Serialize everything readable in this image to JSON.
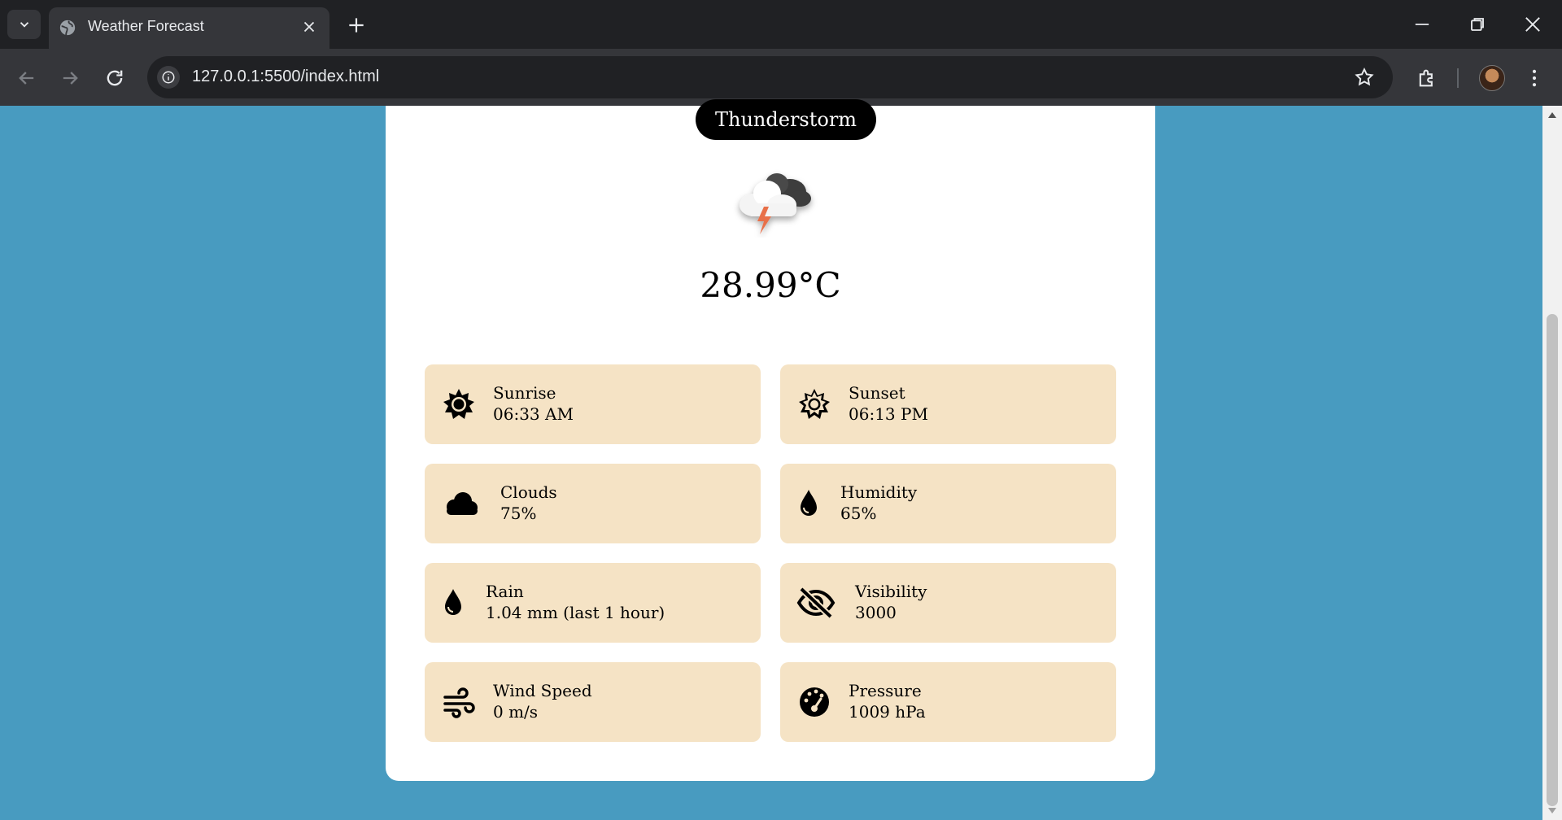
{
  "browser": {
    "tab_title": "Weather Forecast",
    "url": "127.0.0.1:5500/index.html"
  },
  "weather": {
    "condition": "Thunderstorm",
    "temperature": "28.99°C",
    "icon": "thunderstorm-cloud-icon",
    "stats": [
      {
        "label": "Sunrise",
        "value": "06:33 AM",
        "icon": "sun-icon"
      },
      {
        "label": "Sunset",
        "value": "06:13 PM",
        "icon": "sun-outline-icon"
      },
      {
        "label": "Clouds",
        "value": "75%",
        "icon": "cloud-icon"
      },
      {
        "label": "Humidity",
        "value": "65%",
        "icon": "droplet-icon"
      },
      {
        "label": "Rain",
        "value": "1.04 mm (last 1 hour)",
        "icon": "droplet-icon"
      },
      {
        "label": "Visibility",
        "value": "3000",
        "icon": "eye-slash-icon"
      },
      {
        "label": "Wind Speed",
        "value": "0 m/s",
        "icon": "wind-icon"
      },
      {
        "label": "Pressure",
        "value": "1009 hPa",
        "icon": "gauge-icon"
      }
    ]
  },
  "colors": {
    "page_background": "#489bc0",
    "card_background": "#ffffff",
    "stat_background": "#f5e3c5",
    "pill_background": "#000000"
  }
}
